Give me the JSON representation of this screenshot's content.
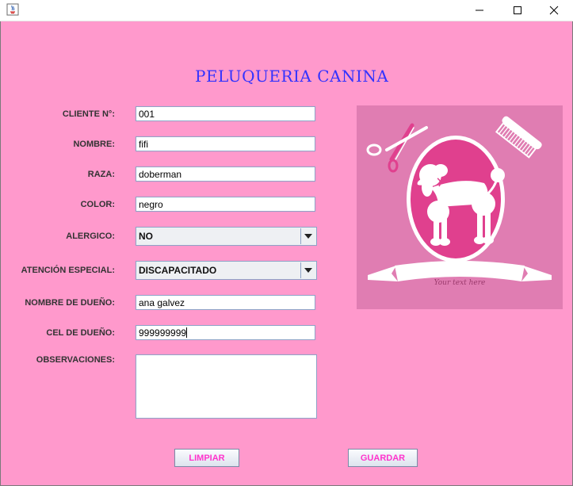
{
  "window": {
    "icon": "java-icon",
    "controls": [
      "minimize-icon",
      "maximize-icon",
      "close-icon"
    ]
  },
  "title": "PELUQUERIA CANINA",
  "form": {
    "cliente_label": "CLIENTE N°:",
    "cliente_value": "001",
    "nombre_label": "NOMBRE:",
    "nombre_value": "fifi",
    "raza_label": "RAZA:",
    "raza_value": "doberman",
    "color_label": "COLOR:",
    "color_value": "negro",
    "alergico_label": "ALERGICO:",
    "alergico_value": "NO",
    "atencion_label": "ATENCIÓN ESPECIAL:",
    "atencion_value": "DISCAPACITADO",
    "dueno_label": "NOMBRE DE DUEÑO:",
    "dueno_value": "ana galvez",
    "cel_label": "CEL DE DUEÑO:",
    "cel_value": "999999999",
    "observaciones_label": "OBSERVACIONES:",
    "observaciones_value": ""
  },
  "logo": {
    "banner_text": "Your text here",
    "colors": {
      "panel": "#e07db2",
      "oval": "#e0408e",
      "white": "#ffffff"
    }
  },
  "buttons": {
    "limpiar": "LIMPIAR",
    "guardar": "GUARDAR"
  },
  "colors": {
    "background": "#ff99cc",
    "title": "#3333ff",
    "button_text": "#ff33cc"
  }
}
